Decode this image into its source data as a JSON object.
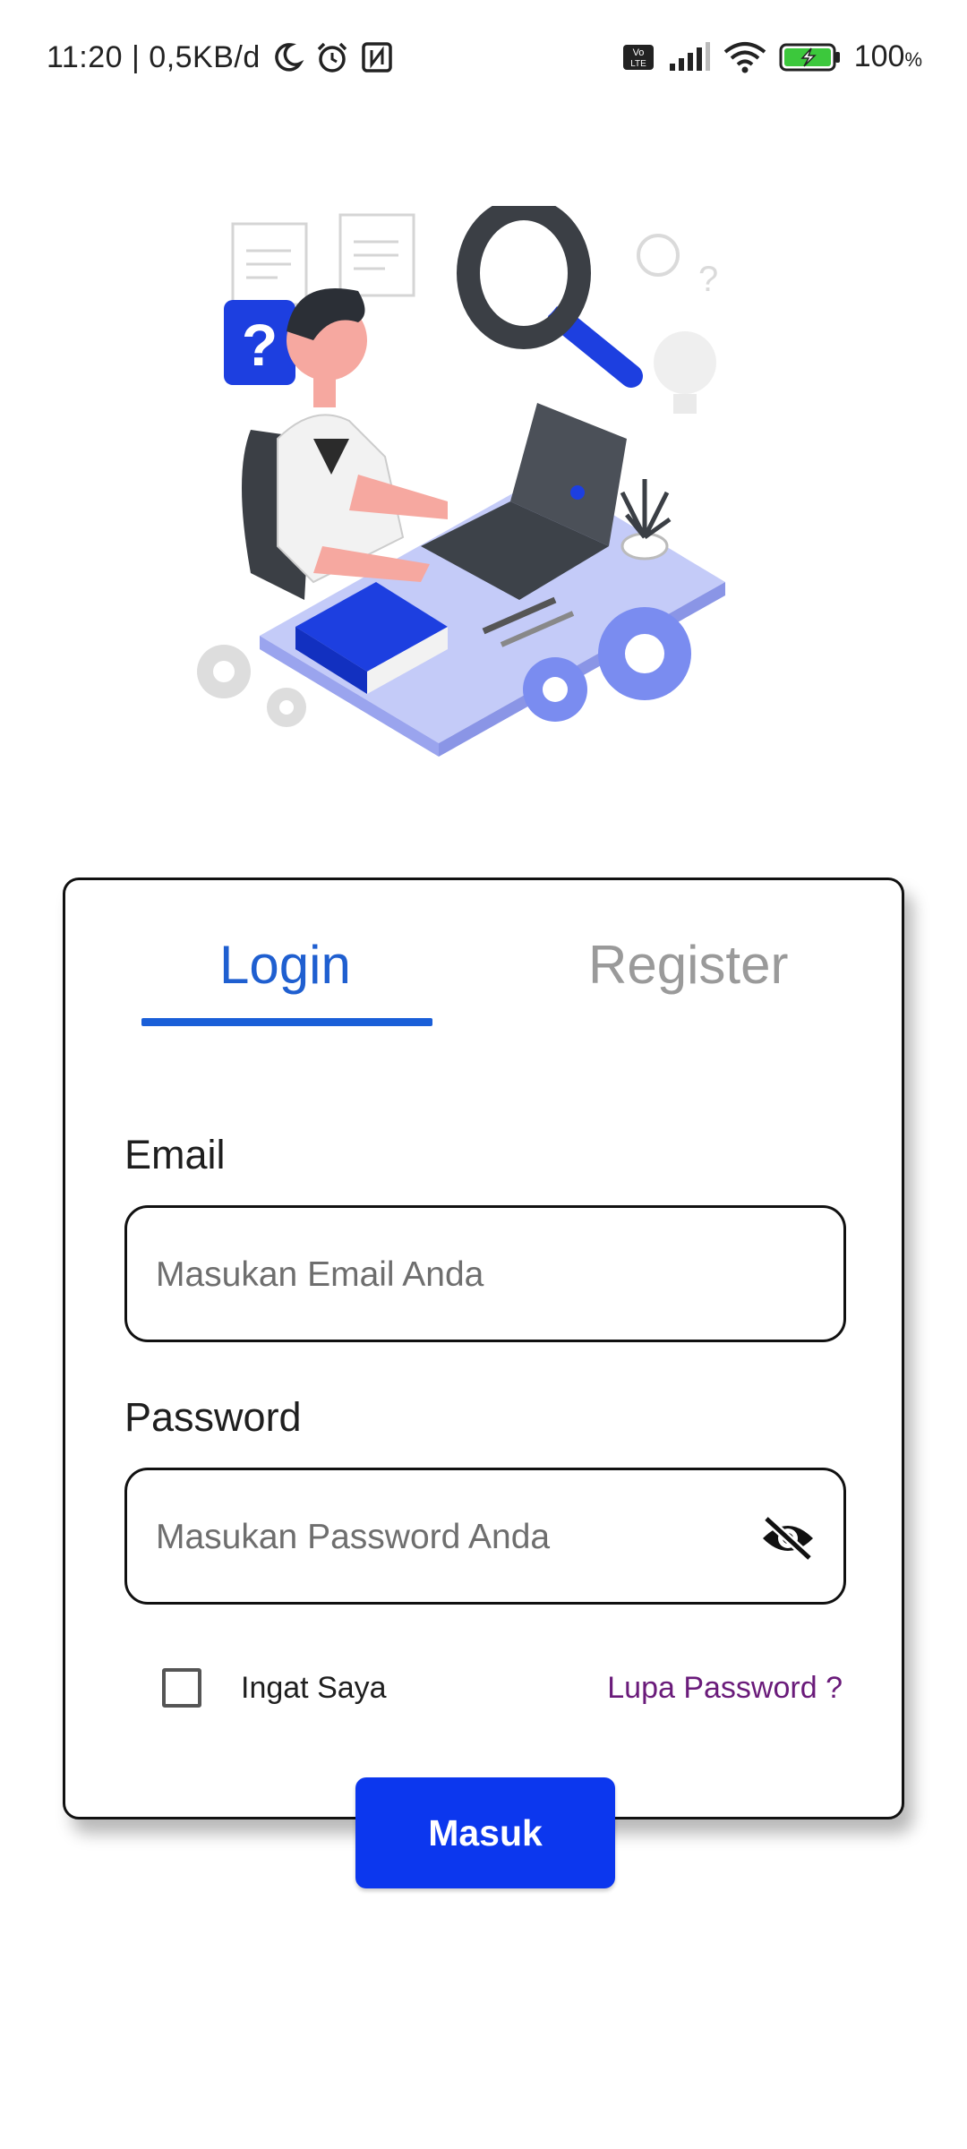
{
  "status_bar": {
    "time": "11:20 | 0,5KB/d",
    "battery_level": "100",
    "battery_unit": "%",
    "icons": [
      "moon-icon",
      "alarm-icon",
      "nfc-icon",
      "volte-icon",
      "signal-icon",
      "wifi-icon",
      "battery-charging-icon"
    ]
  },
  "illustration": {
    "name": "person-at-desk-search-illustration"
  },
  "tabs": {
    "login": "Login",
    "register": "Register",
    "active": "login"
  },
  "form": {
    "email_label": "Email",
    "email_placeholder": "Masukan Email Anda",
    "email_value": "",
    "password_label": "Password",
    "password_placeholder": "Masukan Password Anda",
    "password_value": "",
    "remember_label": "Ingat Saya",
    "remember_checked": false,
    "forgot_label": "Lupa Password ?",
    "submit_label": "Masuk"
  },
  "colors": {
    "accent": "#1a5fd8",
    "button": "#0c37ee",
    "forgot_link": "#6a1b7a",
    "inactive_tab": "#9a9a9a"
  }
}
